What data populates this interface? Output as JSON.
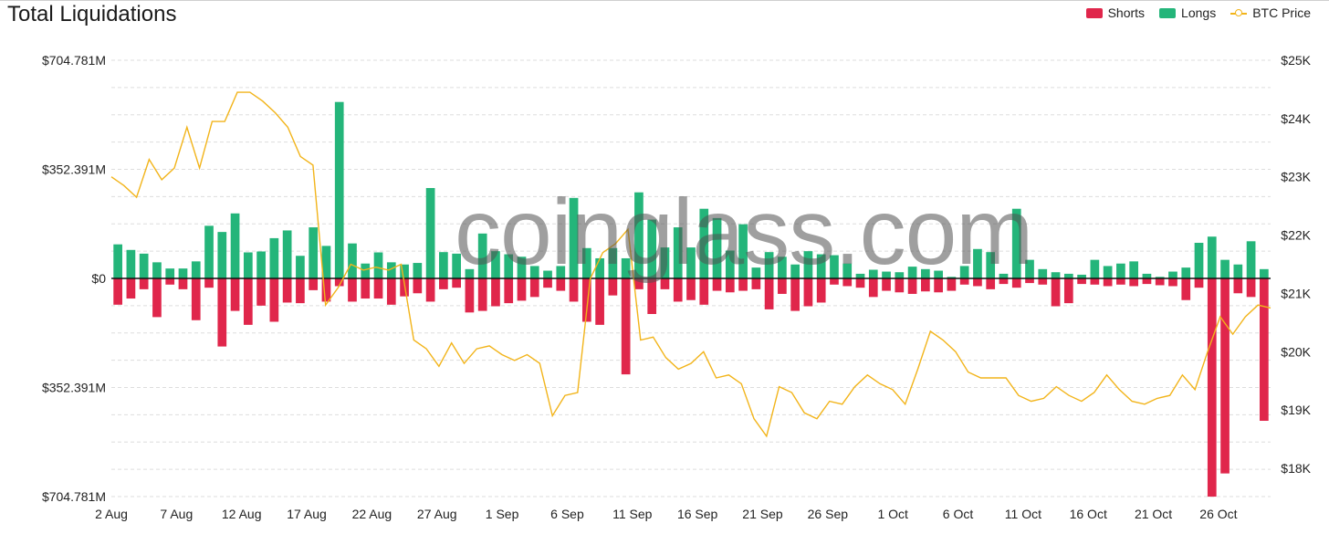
{
  "title": "Total Liquidations",
  "watermark": "coinglass.com",
  "legend": {
    "shorts": "Shorts",
    "longs": "Longs",
    "price": "BTC Price"
  },
  "colors": {
    "shorts": "#e0264b",
    "longs": "#24b57a",
    "price": "#f2b41a",
    "grid": "#dddddd",
    "zero": "#111111"
  },
  "chart_data": {
    "type": "bar",
    "title": "Total Liquidations",
    "y_left_ticks": [
      "$704.781M",
      "$352.391M",
      "$0",
      "$352.391M",
      "$704.781M"
    ],
    "y_left_range": [
      -704.781,
      704.781
    ],
    "y_right_ticks": [
      "$25K",
      "$24K",
      "$23K",
      "$22K",
      "$21K",
      "$20K",
      "$19K",
      "$18K"
    ],
    "y_right_range": [
      17500,
      25000
    ],
    "x_tick_labels": [
      "2 Aug",
      "7 Aug",
      "12 Aug",
      "17 Aug",
      "22 Aug",
      "27 Aug",
      "1 Sep",
      "6 Sep",
      "11 Sep",
      "16 Sep",
      "21 Sep",
      "26 Sep",
      "1 Oct",
      "6 Oct",
      "11 Oct",
      "16 Oct",
      "21 Oct",
      "26 Oct"
    ],
    "x_range": [
      "2 Aug",
      "30 Oct"
    ],
    "grid": true,
    "legend_position": "top-right",
    "series": [
      {
        "name": "Longs",
        "unit": "$M",
        "values": [
          110,
          92,
          80,
          52,
          32,
          32,
          55,
          170,
          150,
          210,
          84,
          87,
          130,
          155,
          73,
          165,
          105,
          570,
          113,
          48,
          84,
          52,
          45,
          50,
          292,
          85,
          80,
          30,
          145,
          88,
          78,
          70,
          40,
          25,
          40,
          260,
          98,
          65,
          98,
          65,
          278,
          190,
          100,
          165,
          100,
          225,
          195,
          90,
          175,
          35,
          85,
          70,
          45,
          88,
          78,
          75,
          48,
          15,
          28,
          22,
          20,
          38,
          30,
          25,
          5,
          40,
          95,
          85,
          15,
          225,
          60,
          30,
          20,
          15,
          12,
          60,
          40,
          48,
          55,
          15,
          5,
          22,
          35,
          115,
          135,
          60,
          45,
          120,
          30
        ]
      },
      {
        "name": "Shorts",
        "unit": "$M",
        "values": [
          85,
          65,
          35,
          125,
          20,
          35,
          135,
          30,
          220,
          105,
          150,
          88,
          140,
          78,
          80,
          38,
          75,
          25,
          75,
          65,
          65,
          85,
          58,
          48,
          75,
          35,
          30,
          110,
          105,
          90,
          80,
          72,
          60,
          30,
          40,
          75,
          140,
          150,
          55,
          310,
          35,
          115,
          35,
          75,
          70,
          85,
          40,
          45,
          40,
          35,
          100,
          50,
          105,
          90,
          78,
          20,
          25,
          30,
          60,
          40,
          45,
          50,
          42,
          45,
          40,
          20,
          25,
          35,
          18,
          30,
          15,
          20,
          90,
          80,
          18,
          20,
          25,
          20,
          25,
          18,
          22,
          25,
          70,
          30,
          705,
          630,
          48,
          60,
          460,
          25
        ]
      },
      {
        "name": "BTC Price",
        "unit": "USD",
        "values": [
          23000,
          22850,
          22650,
          23300,
          22950,
          23150,
          23850,
          23150,
          23950,
          23950,
          24450,
          24450,
          24300,
          24100,
          23850,
          23350,
          23200,
          20800,
          21100,
          21500,
          21400,
          21450,
          21400,
          21500,
          20200,
          20050,
          19750,
          20150,
          19800,
          20050,
          20100,
          19950,
          19850,
          19950,
          19800,
          18900,
          19250,
          19300,
          21250,
          21700,
          21850,
          22100,
          20200,
          20250,
          19900,
          19700,
          19800,
          20000,
          19550,
          19600,
          19450,
          18850,
          18550,
          19400,
          19300,
          18950,
          18850,
          19150,
          19100,
          19400,
          19600,
          19450,
          19350,
          19100,
          19700,
          20350,
          20200,
          20000,
          19650,
          19550,
          19550,
          19550,
          19250,
          19150,
          19200,
          19400,
          19250,
          19150,
          19300,
          19600,
          19350,
          19150,
          19100,
          19200,
          19250,
          19600,
          19350,
          20000,
          20600,
          20300,
          20600,
          20800,
          20750
        ]
      }
    ]
  }
}
